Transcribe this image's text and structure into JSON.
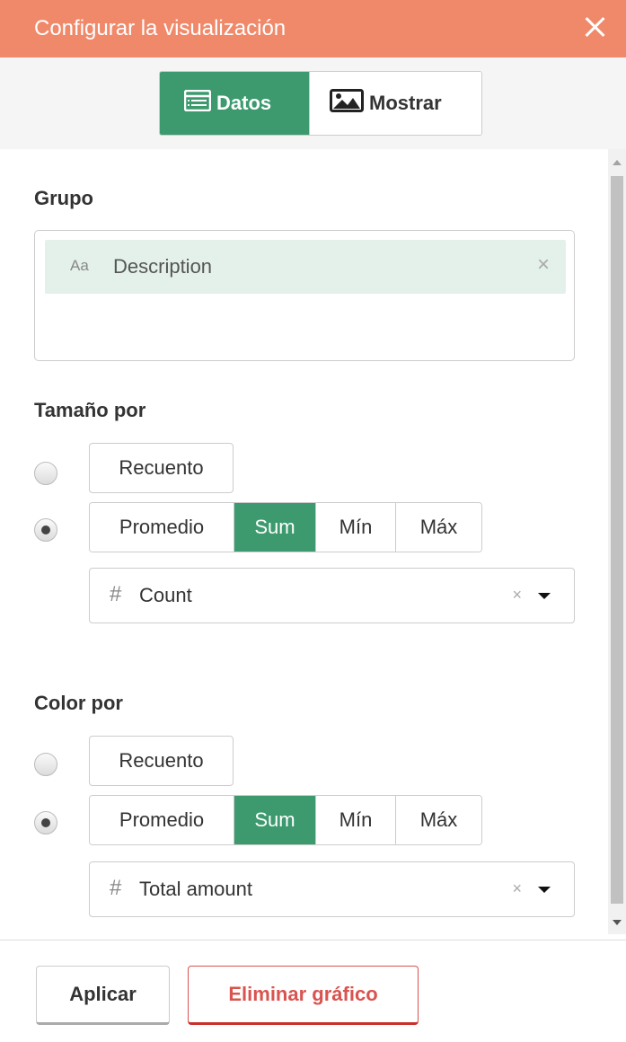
{
  "header": {
    "title": "Configurar la visualización",
    "close_icon": "close-icon"
  },
  "tabs": [
    {
      "label": "Datos",
      "icon": "table-list-icon",
      "active": true
    },
    {
      "label": "Mostrar",
      "icon": "image-icon",
      "active": false
    }
  ],
  "group": {
    "label": "Grupo",
    "chip": {
      "type_icon": "Aa",
      "label": "Description",
      "remove": "×"
    }
  },
  "size_by": {
    "label": "Tamaño por",
    "count_button": "Recuento",
    "aggregations": [
      "Promedio",
      "Sum",
      "Mín",
      "Máx"
    ],
    "active_aggregation": "Sum",
    "selected_option": "aggregation",
    "field": {
      "type_icon": "#",
      "value": "Count",
      "clear": "×"
    }
  },
  "color_by": {
    "label": "Color por",
    "count_button": "Recuento",
    "aggregations": [
      "Promedio",
      "Sum",
      "Mín",
      "Máx"
    ],
    "active_aggregation": "Sum",
    "selected_option": "aggregation",
    "field": {
      "type_icon": "#",
      "value": "Total amount",
      "clear": "×"
    }
  },
  "footer": {
    "apply_label": "Aplicar",
    "delete_label": "Eliminar gráfico"
  },
  "colors": {
    "header_bg": "#f0896a",
    "accent": "#3d9a6e",
    "danger": "#d9534f",
    "chip_bg": "#e4f1ea"
  }
}
